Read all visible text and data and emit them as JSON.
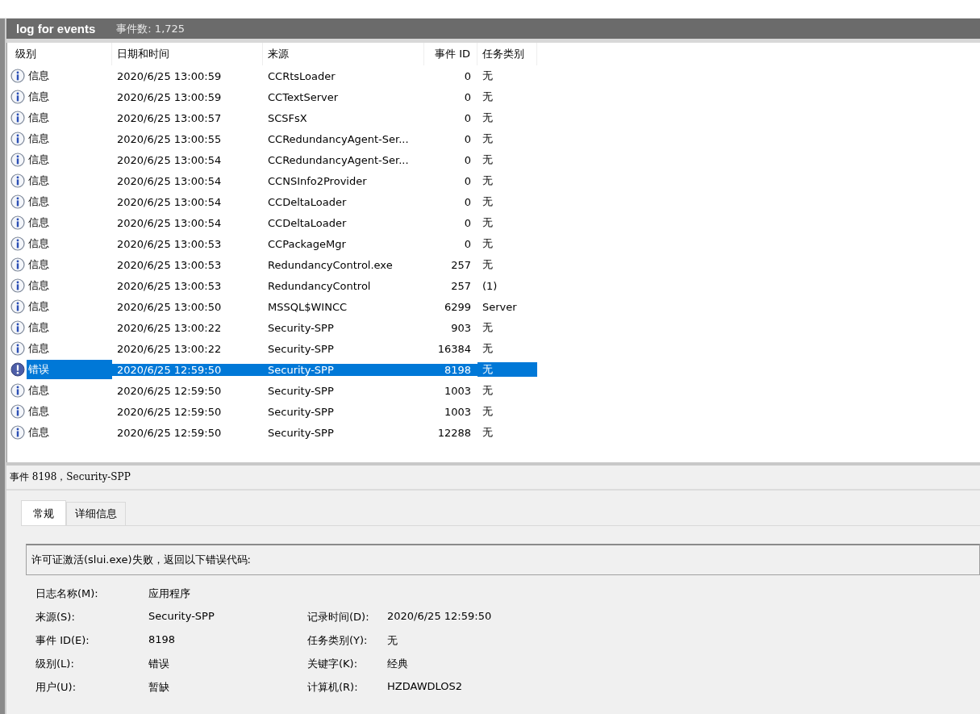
{
  "log_header": {
    "title": "log for events",
    "count": "事件数: 1,725"
  },
  "table": {
    "columns": [
      "级别",
      "日期和时间",
      "来源",
      "事件 ID",
      "任务类别"
    ],
    "rows": [
      {
        "kind": "info",
        "level": "信息",
        "datetime": "2020/6/25 13:00:59",
        "source": "CCRtsLoader",
        "event_id": "0",
        "task": "无",
        "selected": false
      },
      {
        "kind": "info",
        "level": "信息",
        "datetime": "2020/6/25 13:00:59",
        "source": "CCTextServer",
        "event_id": "0",
        "task": "无",
        "selected": false
      },
      {
        "kind": "info",
        "level": "信息",
        "datetime": "2020/6/25 13:00:57",
        "source": "SCSFsX",
        "event_id": "0",
        "task": "无",
        "selected": false
      },
      {
        "kind": "info",
        "level": "信息",
        "datetime": "2020/6/25 13:00:55",
        "source": "CCRedundancyAgent-Ser...",
        "event_id": "0",
        "task": "无",
        "selected": false
      },
      {
        "kind": "info",
        "level": "信息",
        "datetime": "2020/6/25 13:00:54",
        "source": "CCRedundancyAgent-Ser...",
        "event_id": "0",
        "task": "无",
        "selected": false
      },
      {
        "kind": "info",
        "level": "信息",
        "datetime": "2020/6/25 13:00:54",
        "source": "CCNSInfo2Provider",
        "event_id": "0",
        "task": "无",
        "selected": false
      },
      {
        "kind": "info",
        "level": "信息",
        "datetime": "2020/6/25 13:00:54",
        "source": "CCDeltaLoader",
        "event_id": "0",
        "task": "无",
        "selected": false
      },
      {
        "kind": "info",
        "level": "信息",
        "datetime": "2020/6/25 13:00:54",
        "source": "CCDeltaLoader",
        "event_id": "0",
        "task": "无",
        "selected": false
      },
      {
        "kind": "info",
        "level": "信息",
        "datetime": "2020/6/25 13:00:53",
        "source": "CCPackageMgr",
        "event_id": "0",
        "task": "无",
        "selected": false
      },
      {
        "kind": "info",
        "level": "信息",
        "datetime": "2020/6/25 13:00:53",
        "source": "RedundancyControl.exe",
        "event_id": "257",
        "task": "无",
        "selected": false
      },
      {
        "kind": "info",
        "level": "信息",
        "datetime": "2020/6/25 13:00:53",
        "source": "RedundancyControl",
        "event_id": "257",
        "task": "(1)",
        "selected": false
      },
      {
        "kind": "info",
        "level": "信息",
        "datetime": "2020/6/25 13:00:50",
        "source": "MSSQL$WINCC",
        "event_id": "6299",
        "task": "Server",
        "selected": false
      },
      {
        "kind": "info",
        "level": "信息",
        "datetime": "2020/6/25 13:00:22",
        "source": "Security-SPP",
        "event_id": "903",
        "task": "无",
        "selected": false
      },
      {
        "kind": "info",
        "level": "信息",
        "datetime": "2020/6/25 13:00:22",
        "source": "Security-SPP",
        "event_id": "16384",
        "task": "无",
        "selected": false
      },
      {
        "kind": "error",
        "level": "错误",
        "datetime": "2020/6/25 12:59:50",
        "source": "Security-SPP",
        "event_id": "8198",
        "task": "无",
        "selected": true
      },
      {
        "kind": "info",
        "level": "信息",
        "datetime": "2020/6/25 12:59:50",
        "source": "Security-SPP",
        "event_id": "1003",
        "task": "无",
        "selected": false
      },
      {
        "kind": "info",
        "level": "信息",
        "datetime": "2020/6/25 12:59:50",
        "source": "Security-SPP",
        "event_id": "1003",
        "task": "无",
        "selected": false
      },
      {
        "kind": "info",
        "level": "信息",
        "datetime": "2020/6/25 12:59:50",
        "source": "Security-SPP",
        "event_id": "12288",
        "task": "无",
        "selected": false
      }
    ]
  },
  "detail": {
    "title": "事件 8198，Security-SPP",
    "tabs": [
      {
        "label": "常规",
        "selected": true
      },
      {
        "label": "详细信息",
        "selected": false
      }
    ],
    "description": "许可证激活(slui.exe)失败，返回以下错误代码:",
    "fields": [
      {
        "label": "日志名称(M):",
        "value": "应用程序"
      },
      {
        "label": "来源(S):",
        "value": "Security-SPP",
        "label_2": "记录时间(D):",
        "value_2": "2020/6/25 12:59:50"
      },
      {
        "label": "事件 ID(E):",
        "value": "8198",
        "label_2": "任务类别(Y):",
        "value_2": "无"
      },
      {
        "label": "级别(L):",
        "value": "错误",
        "label_2": "关键字(K):",
        "value_2": "经典"
      },
      {
        "label": "用户(U):",
        "value": "暂缺",
        "label_2": "计算机(R):",
        "value_2": "HZDAWDLOS2"
      }
    ]
  }
}
